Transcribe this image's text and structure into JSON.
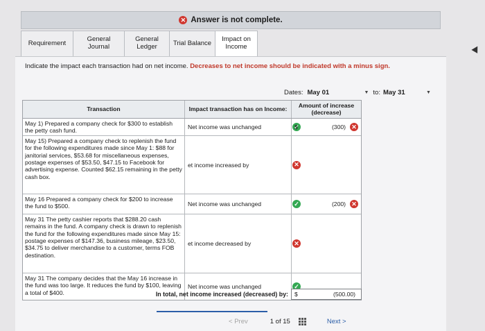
{
  "banner": {
    "text": "Answer is not complete."
  },
  "tabs": [
    {
      "label": "Requirement"
    },
    {
      "label": "General Journal"
    },
    {
      "label": "General Ledger"
    },
    {
      "label": "Trial Balance"
    },
    {
      "label": "Impact on Income"
    }
  ],
  "instructions": {
    "main": "Indicate the impact each transaction had on net income.",
    "emphasis": "Decreases to net income should be indicated with a minus sign."
  },
  "dates": {
    "label": "Dates:",
    "from": "May 01",
    "to_label": "to:",
    "to": "May 31"
  },
  "table": {
    "headers": {
      "transaction": "Transaction",
      "impact": "Impact transaction has on Income:",
      "amount": "Amount of increase (decrease)"
    },
    "rows": [
      {
        "transaction": "May 1) Prepared a company check for $300 to establish the petty cash fund.",
        "impact": "Net income was unchanged",
        "impact_status": "correct",
        "dollar": "$",
        "amount": "(300)",
        "amount_status": "incorrect"
      },
      {
        "transaction": "May 15) Prepared a company check to replenish the fund for the following expenditures made since May 1: $88 for janitorial services, $53.68 for miscellaneous expenses, postage expenses of $53.50, $47.15 to Facebook for advertising expense. Counted $62.15 remaining in the petty cash box.",
        "impact": "et income increased by",
        "impact_status": "incorrect",
        "dollar": "",
        "amount": "",
        "amount_status": ""
      },
      {
        "transaction": "May 16 Prepared a company check for $200 to increase the fund to $500.",
        "impact": "Net income was unchanged",
        "impact_status": "correct",
        "dollar": "",
        "amount": "(200)",
        "amount_status": "incorrect"
      },
      {
        "transaction": "May 31 The petty cashier reports that $288.20 cash remains in the fund. A company check is drawn to replenish the fund for the following expenditures made since May 15: postage expenses of $147.36, business mileage, $23.50, $34.75 to deliver merchandise to a customer, terms FOB destination.",
        "impact": "et income decreased by",
        "impact_status": "incorrect",
        "dollar": "",
        "amount": "",
        "amount_status": ""
      },
      {
        "transaction": "May 31 The company decides that the May 16 increase in the fund was too large. It reduces the fund by $100, leaving a total of $400.",
        "impact": "Net income was unchanged",
        "impact_status": "correct",
        "dollar": "",
        "amount": "",
        "amount_status": ""
      }
    ],
    "total": {
      "label": "In total, net income increased (decreased) by:",
      "dollar": "$",
      "amount": "(500.00)"
    }
  },
  "pager": {
    "prev": "Prev",
    "current": "1",
    "of": "of",
    "total": "15",
    "next": "Next"
  },
  "colors": {
    "incorrect": "#d0372f",
    "correct": "#34a853",
    "link": "#2b5ea8"
  }
}
